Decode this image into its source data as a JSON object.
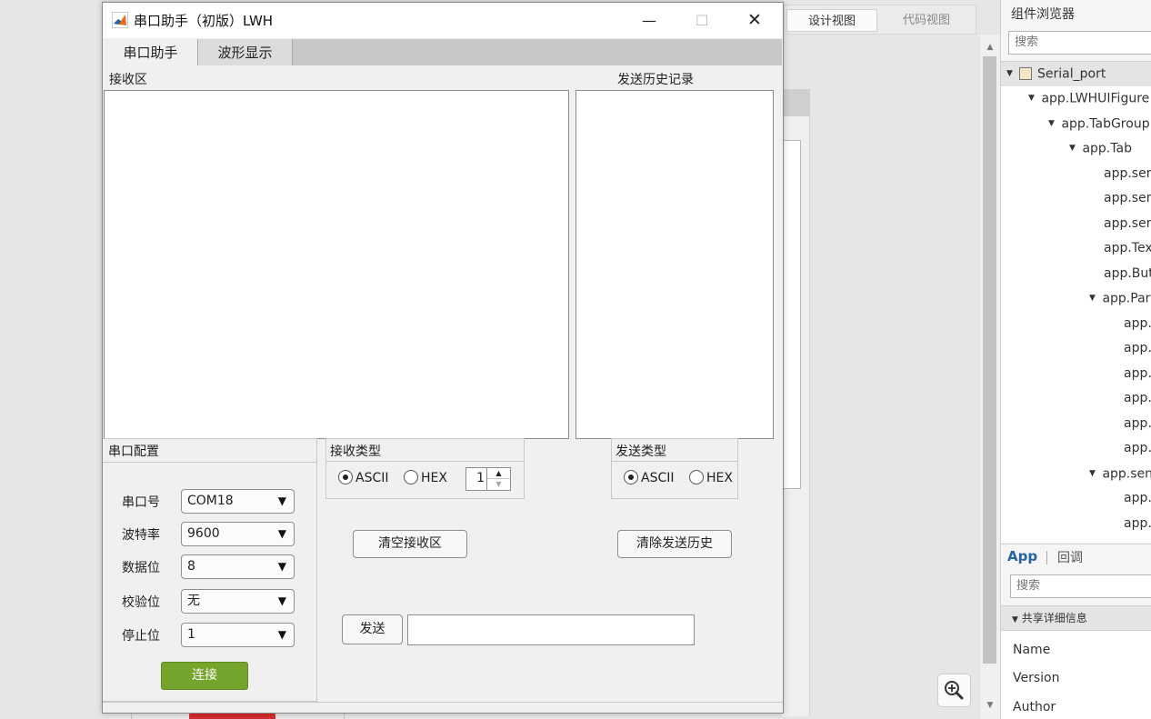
{
  "designer": {
    "view_tabs": {
      "design": "设计视图",
      "code": "代码视图"
    },
    "component_browser": {
      "title": "组件浏览器",
      "search_placeholder": "搜索",
      "tree": [
        {
          "label": "Serial_port"
        },
        {
          "label": "app.LWHUIFigure"
        },
        {
          "label": "app.TabGroup"
        },
        {
          "label": "app.Tab"
        },
        {
          "label": "app.sen"
        },
        {
          "label": "app.sen"
        },
        {
          "label": "app.sen"
        },
        {
          "label": "app.Tex"
        },
        {
          "label": "app.But"
        },
        {
          "label": "app.Par"
        },
        {
          "label": "app."
        },
        {
          "label": "app."
        },
        {
          "label": "app.("
        },
        {
          "label": "app."
        },
        {
          "label": "app."
        },
        {
          "label": "app."
        },
        {
          "label": "app.sen"
        },
        {
          "label": "app."
        },
        {
          "label": "app."
        }
      ]
    },
    "props": {
      "tab_app": "App",
      "tab_callback": "回调",
      "search_placeholder": "搜索",
      "section": "共享详细信息",
      "labels": [
        "Name",
        "Version",
        "Author"
      ]
    }
  },
  "window": {
    "title": "串口助手（初版）LWH",
    "controls": {
      "minimize": "—",
      "maximize": "☐",
      "close": "✕"
    }
  },
  "tabs": [
    "串口助手",
    "波形显示"
  ],
  "receive": {
    "label": "接收区"
  },
  "history": {
    "label": "发送历史记录"
  },
  "config": {
    "title": "串口配置",
    "fields": [
      {
        "label": "串口号",
        "value": "COM18"
      },
      {
        "label": "波特率",
        "value": "9600"
      },
      {
        "label": "数据位",
        "value": "8"
      },
      {
        "label": "校验位",
        "value": "无"
      },
      {
        "label": "停止位",
        "value": "1"
      }
    ],
    "connect_label": "连接"
  },
  "receive_type": {
    "title": "接收类型",
    "options": [
      "ASCII",
      "HEX"
    ],
    "selected": "ASCII",
    "spinner_value": "1"
  },
  "send_type": {
    "title": "发送类型",
    "options": [
      "ASCII",
      "HEX"
    ],
    "selected": "ASCII"
  },
  "buttons": {
    "clear_receive": "清空接收区",
    "clear_history": "清除发送历史",
    "send": "发送"
  },
  "send_input": {
    "value": ""
  },
  "colors": {
    "connect": "#75a42d",
    "app_tab": "#2463a8"
  }
}
